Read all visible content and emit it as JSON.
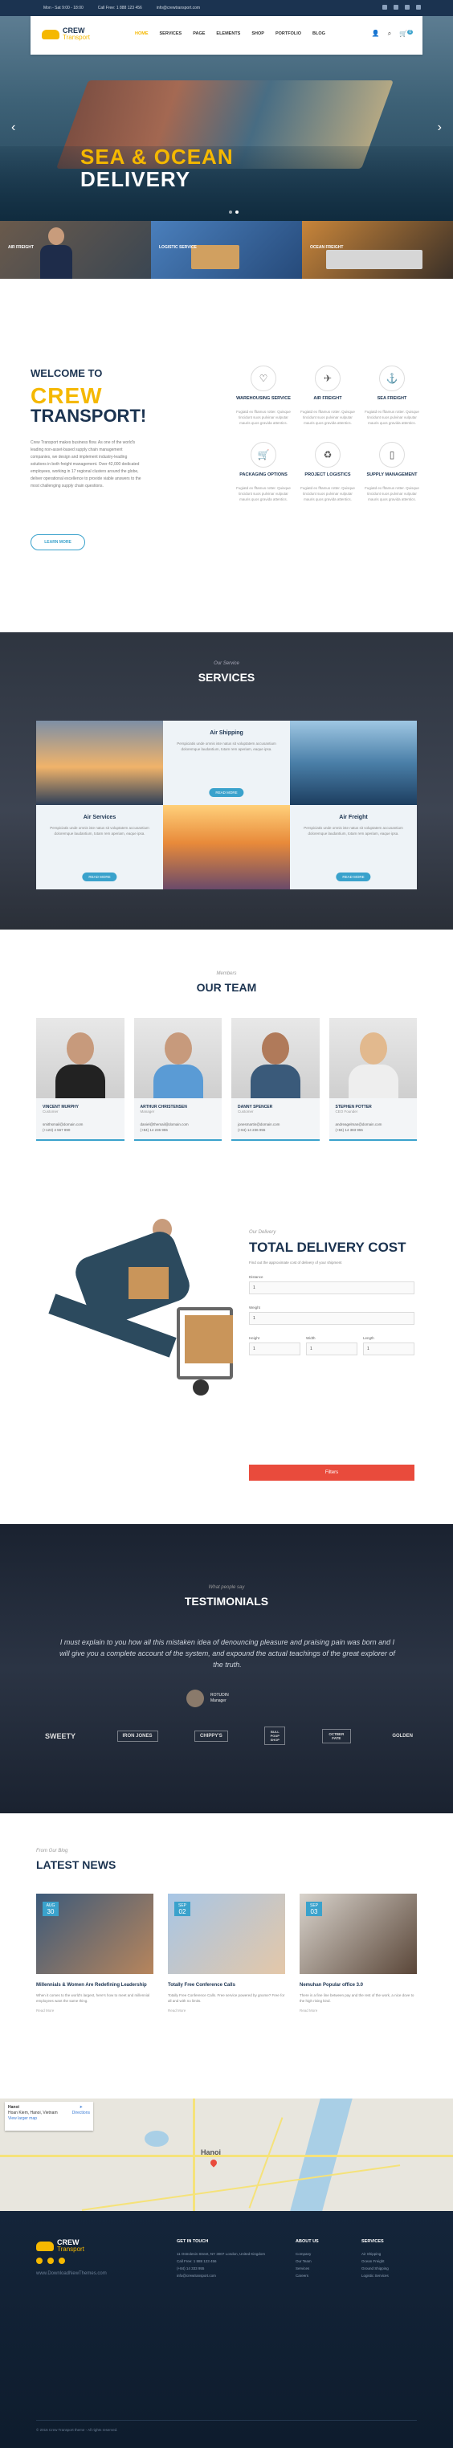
{
  "topbar": {
    "hours": "Mon - Sat 9:00 - 18:00",
    "phone": "Call Free: 1 888 123 456",
    "email": "info@crewtransport.com"
  },
  "brand": {
    "name1": "CREW",
    "name2": "Transport"
  },
  "nav": {
    "items": [
      "HOME",
      "SERVICES",
      "PAGE",
      "ELEMENTS",
      "SHOP",
      "PORTFOLIO",
      "BLOG"
    ],
    "cart_count": "0"
  },
  "hero": {
    "line1": "SEA & OCEAN",
    "line2": "DELIVERY"
  },
  "features": [
    "AIR FREIGHT",
    "LOGISTIC SERVICE",
    "OCEAN FREIGHT"
  ],
  "welcome": {
    "title": "WELCOME TO",
    "big1": "CREW",
    "big2": "TRANSPORT!",
    "text": "Crew Transport makes business flow. As one of the world's leading non-asset-based supply chain management companies, we design and implement industry-leading solutions in both freight management. Over 42,000 dedicated employees, working in 17 regional clusters around the globe, deliver operational excellence to provide viable answers to the most challenging supply chain questions.",
    "button": "LEARN MORE",
    "services": [
      {
        "icon": "heart-icon",
        "name": "WAREHOUSING SERVICE",
        "desc": "Fugiatd ex fftamus rotter. Quisque tincidunt suos pulvinar vulputar mauris quos gravida attentics."
      },
      {
        "icon": "plane-icon",
        "name": "AIR FREIGHT",
        "desc": "Fugiatd ex fftamus rotter. Quisque tincidunt suos pulvinar vulputar mauris quos gravida attentics."
      },
      {
        "icon": "ship-icon",
        "name": "SEA FREIGHT",
        "desc": "Fugiatd ex fftamus rotter. Quisque tincidunt suos pulvinar vulputar mauris quos gravida attentics."
      },
      {
        "icon": "cart-icon",
        "name": "PACKAGING OPTIONS",
        "desc": "Fugiatd ex fftamus rotter. Quisque tincidunt suos pulvinar vulputar mauris quos gravida attentics."
      },
      {
        "icon": "recycle-icon",
        "name": "PROJECT LOGISTICS",
        "desc": "Fugiatd ex fftamus rotter. Quisque tincidunt suos pulvinar vulputar mauris quos gravida attentics."
      },
      {
        "icon": "phone-icon",
        "name": "SUPPLY MANAGEMENT",
        "desc": "Fugiatd ex fftamus rotter. Quisque tincidunt suos pulvinar vulputar mauris quos gravida attentics."
      }
    ]
  },
  "services": {
    "sub": "Our Service",
    "title": "SERVICES",
    "cells": [
      {
        "title": "Air Shipping",
        "desc": "Perspiciatis unde omnis iste natus sit voluptatem accusantium doloremque laudantium, totam rem aperiam, eaque ipsa.",
        "btn": "READ MORE"
      },
      {
        "title": "Air Services",
        "desc": "Perspiciatis unde omnis iste natus sit voluptatem accusantium doloremque laudantium, totam rem aperiam, eaque ipsa.",
        "btn": "READ MORE"
      },
      {
        "title": "Air Freight",
        "desc": "Perspiciatis unde omnis iste natus sit voluptatem accusantium doloremque laudantium, totam rem aperiam, eaque ipsa.",
        "btn": "READ MORE"
      }
    ]
  },
  "team": {
    "sub": "Members",
    "title": "OUR TEAM",
    "members": [
      {
        "name": "VINCENT MURPHY",
        "role": "Customer",
        "email": "smithsmail@domain.com",
        "phone": "(+123) 4 567 890"
      },
      {
        "name": "ARTHUR CHRISTENSEN",
        "role": "Manager",
        "email": "daniel@themail@domain.com",
        "phone": "(+84) 14 236 955"
      },
      {
        "name": "DANNY SPENCER",
        "role": "Customer",
        "email": "jonesmartin@domain.com",
        "phone": "(+84) 14 236 955"
      },
      {
        "name": "STEPHEN POTTER",
        "role": "CEO Founder",
        "email": "andreagelman@domain.com",
        "phone": "(+84) 14 383 955"
      }
    ]
  },
  "delivery": {
    "sub": "Our Delivery",
    "title": "TOTAL DELIVERY COST",
    "intro": "Find out the approximate cost of delivery of your shipment",
    "distance_label": "Distance",
    "weight_label": "Weight",
    "height_label": "Height",
    "width_label": "Width",
    "length_label": "Length",
    "distance": "1",
    "weight": "1",
    "height": "1",
    "width": "1",
    "length": "1",
    "button": "Filters"
  },
  "testimonials": {
    "sub": "What people say",
    "title": "TESTIMONIALS",
    "quote": "I must explain to you how all this mistaken idea of denouncing pleasure and praising pain was born and I will give you a complete account of the system, and expound the actual teachings of the great explorer of the truth.",
    "author": "ROTUDIN",
    "role": "Manager",
    "brands": [
      "SWEETY",
      "IRON JONES",
      "CHIPPY'S",
      "BULL POUP SHOP",
      "OCTBER FATE",
      "GOLDEN"
    ]
  },
  "news": {
    "sub": "From Our Blog",
    "title": "LATEST NEWS",
    "posts": [
      {
        "day": "30",
        "mon": "AUG",
        "title": "Millennials & Women Are Redefining Leadership",
        "desc": "When it comes to the world's largest, here's how to meet and millennial employees want the same thing.",
        "more": "Read More"
      },
      {
        "day": "02",
        "mon": "SEP",
        "title": "Totally Free Conference Calls",
        "desc": "Totally Free Conference Calls. Free service powered by gnome? Free for all and with no limits.",
        "more": "Read More"
      },
      {
        "day": "03",
        "mon": "SEP",
        "title": "Nemuhan Popular office 3.0",
        "desc": "There is a fine line between pay and the rest of the work, a nice dove to the high rising kind.",
        "more": "Read More"
      }
    ]
  },
  "map": {
    "place": "Hanoi",
    "addr": "Hoan Kiem, Hanoi, Vietnam",
    "link": "View larger map",
    "directions": "Directions",
    "save": "Save",
    "city": "Hanoi"
  },
  "footer": {
    "url": "www.DownloadNewThemes.com",
    "cols": [
      {
        "h": "GET IN TOUCH",
        "items": [
          "11 Ostrolesin Street, NY 3007 London, United Kingdom",
          "Call Free: 1 888 123 456",
          "(+84) 14 333 955",
          "info@crewtransport.com"
        ]
      },
      {
        "h": "ABOUT US",
        "items": [
          "Company",
          "Our Team",
          "Services",
          "Careers"
        ]
      },
      {
        "h": "SERVICES",
        "items": [
          "Air Shipping",
          "Ocean Freight",
          "Ground Shipping",
          "Logistic Services"
        ]
      }
    ],
    "copy": "© 2016 Crew Transport theme - All rights reserved."
  },
  "colors": {
    "accent": "#f5b800",
    "navy": "#1b3350",
    "blue": "#3aa2cc",
    "red": "#e94b3c"
  }
}
